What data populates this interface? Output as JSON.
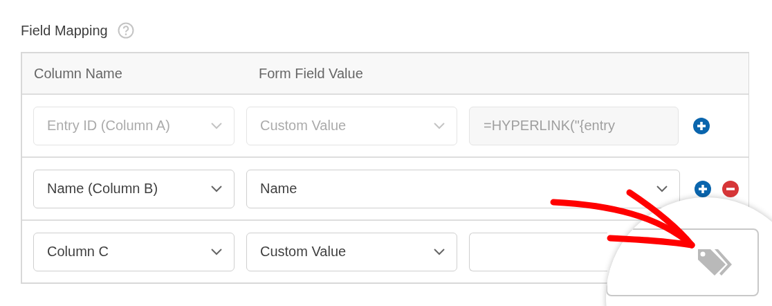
{
  "section": {
    "title": "Field Mapping"
  },
  "table": {
    "columns": [
      "Column Name",
      "Form Field Value"
    ],
    "rows": [
      {
        "disabled": true,
        "column": "Entry ID (Column A)",
        "field": "Custom Value",
        "value": "=HYPERLINK(\"{entry",
        "add_button": true,
        "remove_button": false
      },
      {
        "disabled": false,
        "column": "Name (Column B)",
        "field": "Name",
        "add_button": true,
        "remove_button": true
      },
      {
        "disabled": false,
        "column": "Column C",
        "field": "Custom Value",
        "value": ""
      }
    ]
  }
}
